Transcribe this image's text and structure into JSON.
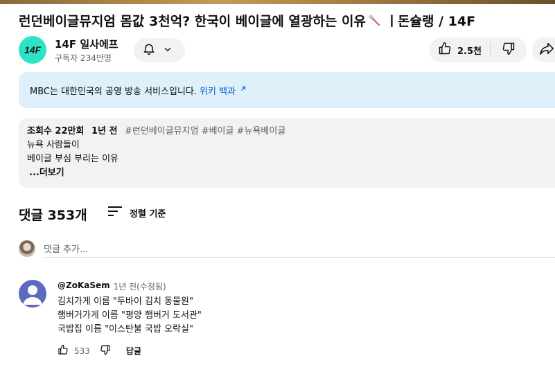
{
  "video": {
    "title": "런던베이글뮤지엄 몸값 3천억? 한국이 베이글에 열광하는 이유",
    "title_suffix": "ㅣ돈슐랭 / 14F"
  },
  "channel": {
    "logo_text": "14F",
    "name": "14F 일사에프",
    "subscribers": "구독자 234만명"
  },
  "actions": {
    "like_count": "2.5천"
  },
  "info_panel": {
    "text": "MBC는 대한민국의 공영 방송 서비스입니다.",
    "link": "위키 백과"
  },
  "description": {
    "views": "조회수 22만회",
    "age": "1년 전",
    "tags": "#런던베이글뮤지엄 #베이글 #뉴욕베이글",
    "line1": "뉴욕 사람들이",
    "line2": "베이글 부심 부리는 이유",
    "more": "...더보기"
  },
  "comments": {
    "header": "댓글 353개",
    "sort_label": "정렬 기준",
    "add_placeholder": "댓글 추가...",
    "items": [
      {
        "author": "@ZoKaSem",
        "time": "1년 전(수정됨)",
        "lines": [
          "김치가게 이름 \"두바이 김치 동물원\"",
          "햄버거가게 이름 \"평양 햄버거 도서관\"",
          "국밥집 이름 \"이스탄불 국밥 오락실\""
        ],
        "likes": "533",
        "reply_label": "답글"
      }
    ]
  },
  "colors": {
    "info_bg": "#def1fb",
    "link": "#065fd4",
    "logo_bg": "#2de3c6",
    "commenter_avatar": "#5c6bc0"
  }
}
